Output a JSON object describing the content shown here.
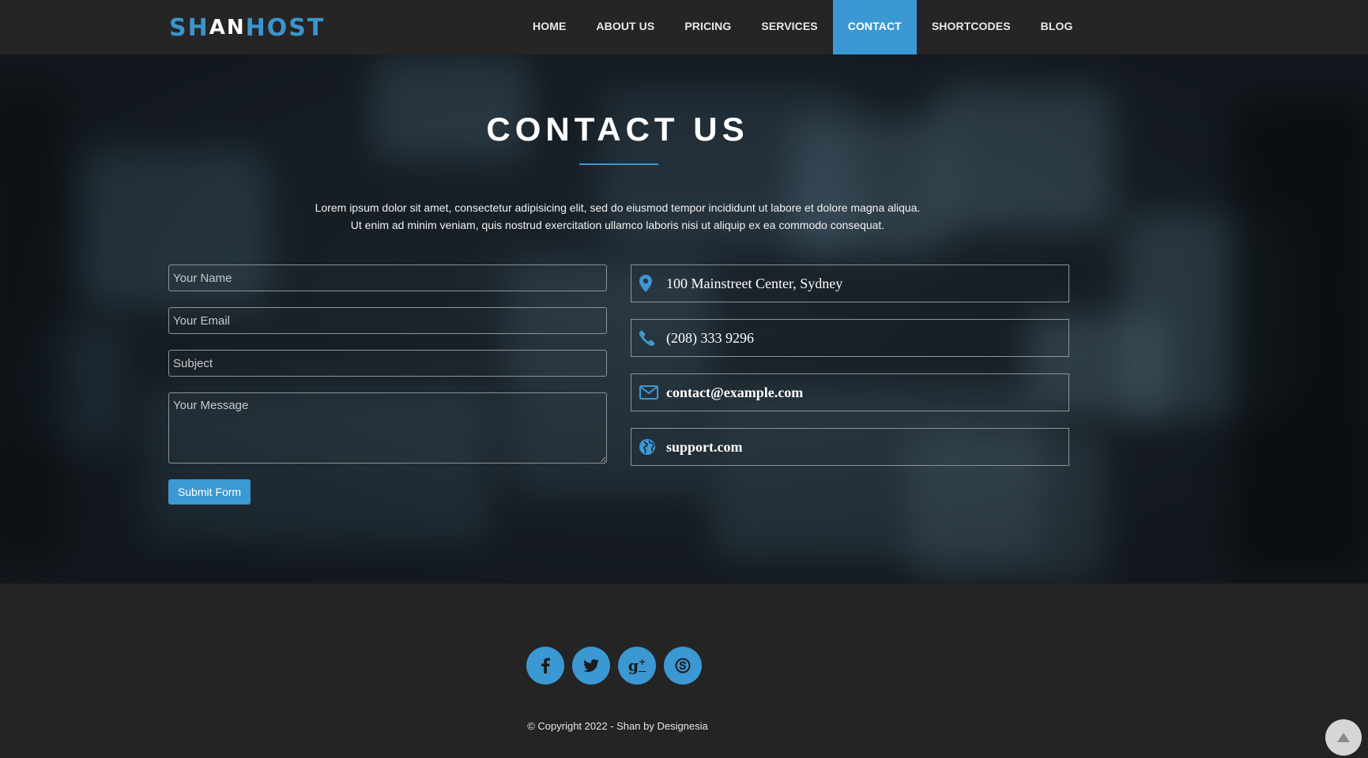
{
  "brand": {
    "part1": "SH",
    "part2": "AN",
    "part3": "HOST",
    "accent_color": "#3c98d2"
  },
  "nav": {
    "items": [
      {
        "label": "HOME"
      },
      {
        "label": "ABOUT US"
      },
      {
        "label": "PRICING"
      },
      {
        "label": "SERVICES"
      },
      {
        "label": "CONTACT",
        "active": true
      },
      {
        "label": "SHORTCODES"
      },
      {
        "label": "BLOG"
      }
    ]
  },
  "hero": {
    "title": "CONTACT US",
    "intro_line1": "Lorem ipsum dolor sit amet, consectetur adipisicing elit, sed do eiusmod tempor incididunt ut labore et dolore magna aliqua.",
    "intro_line2": "Ut enim ad minim veniam, quis nostrud exercitation ullamco laboris nisi ut aliquip ex ea commodo consequat."
  },
  "form": {
    "name_placeholder": "Your Name",
    "email_placeholder": "Your Email",
    "subject_placeholder": "Subject",
    "message_placeholder": "Your Message",
    "submit_label": "Submit Form"
  },
  "contact_info": {
    "address": {
      "icon": "map-marker-icon",
      "text": "100 Mainstreet Center, Sydney"
    },
    "phone": {
      "icon": "phone-icon",
      "text": "(208) 333 9296"
    },
    "email": {
      "icon": "envelope-icon",
      "text": "contact@example.com"
    },
    "website": {
      "icon": "globe-icon",
      "text": "support.com"
    }
  },
  "footer": {
    "socials": [
      {
        "icon": "facebook-icon",
        "glyph": "f"
      },
      {
        "icon": "twitter-icon",
        "glyph": "t"
      },
      {
        "icon": "google-plus-icon",
        "glyph": "g+"
      },
      {
        "icon": "skype-icon",
        "glyph": "S"
      }
    ],
    "copyright": "© Copyright 2022 - Shan by Designesia"
  },
  "back_to_top_icon": "arrow-up-icon"
}
